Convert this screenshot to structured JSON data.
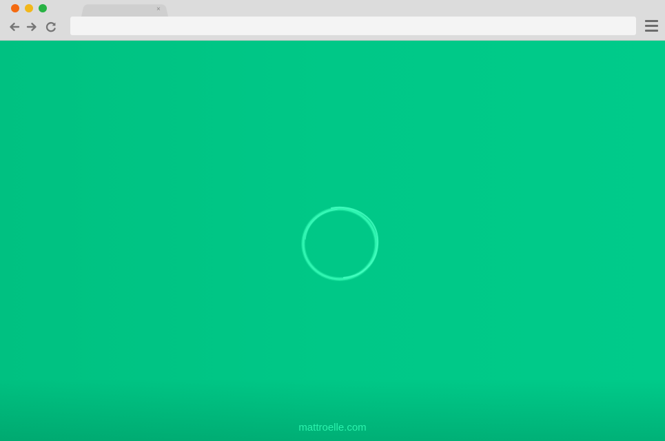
{
  "window": {
    "traffic_lights": {
      "close_color": "#f46a10",
      "minimize_color": "#f2b71a",
      "maximize_color": "#28b244"
    }
  },
  "tab": {
    "title": "",
    "close_glyph": "×"
  },
  "toolbar": {
    "back_icon": "arrow-left-icon",
    "forward_icon": "arrow-right-icon",
    "reload_icon": "reload-icon",
    "address_value": "",
    "menu_icon": "hamburger-menu-icon"
  },
  "page": {
    "background_color": "#00c684",
    "loader_color": "#2ff5b1",
    "footer_link": "mattroelle.com"
  }
}
